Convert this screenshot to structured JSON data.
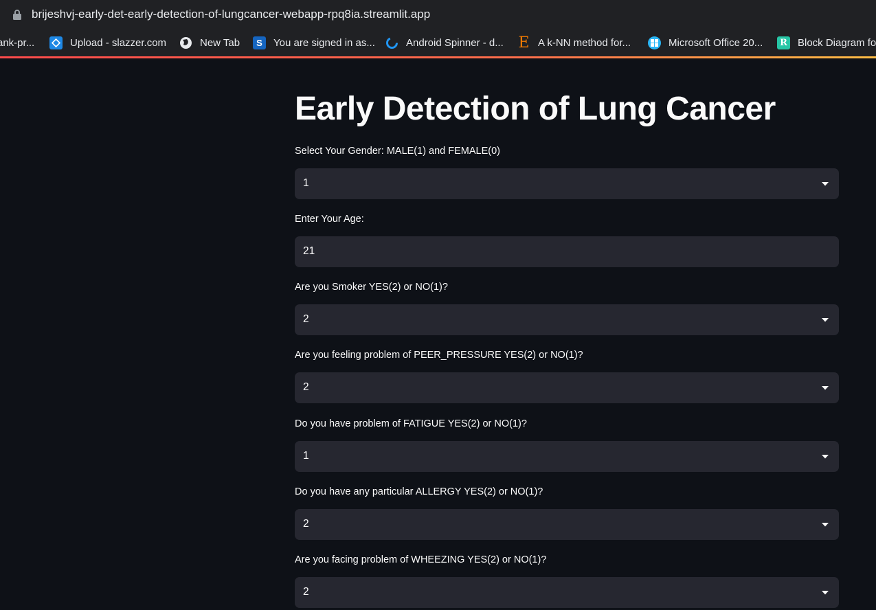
{
  "browser": {
    "url": "brijeshvj-early-det-early-detection-of-lungcancer-webapp-rpq8ia.streamlit.app",
    "bookmarks": [
      {
        "label": "ank-pr..."
      },
      {
        "label": "Upload - slazzer.com",
        "icon": "slazzer-icon"
      },
      {
        "label": "New Tab",
        "icon": "globe-icon"
      },
      {
        "label": "You are signed in as...",
        "icon": "s-logo-icon"
      },
      {
        "label": "Android Spinner - d...",
        "icon": "spinner-icon"
      },
      {
        "label": "A k-NN method for...",
        "icon": "e-logo-icon"
      },
      {
        "label": "Microsoft Office 20...",
        "icon": "windows-icon"
      },
      {
        "label": "Block Diagram fo",
        "icon": "r-logo-icon"
      }
    ]
  },
  "app": {
    "title": "Early Detection of Lung Cancer",
    "fields": [
      {
        "label": "Select Your Gender: MALE(1) and FEMALE(0)",
        "type": "select",
        "value": "1"
      },
      {
        "label": "Enter Your Age:",
        "type": "input",
        "value": "21"
      },
      {
        "label": "Are you Smoker YES(2) or NO(1)?",
        "type": "select",
        "value": "2"
      },
      {
        "label": "Are you feeling problem of PEER_PRESSURE YES(2) or NO(1)?",
        "type": "select",
        "value": "2"
      },
      {
        "label": "Do you have problem of FATIGUE YES(2) or NO(1)?",
        "type": "select",
        "value": "1"
      },
      {
        "label": "Do you have any particular ALLERGY YES(2) or NO(1)?",
        "type": "select",
        "value": "2"
      },
      {
        "label": "Are you facing problem of WHEEZING YES(2) or NO(1)?",
        "type": "select",
        "value": "2"
      }
    ]
  },
  "colors": {
    "background": "#0e1117",
    "widget": "#262730",
    "text": "#fafafa",
    "accent": "#ff4b4b"
  }
}
